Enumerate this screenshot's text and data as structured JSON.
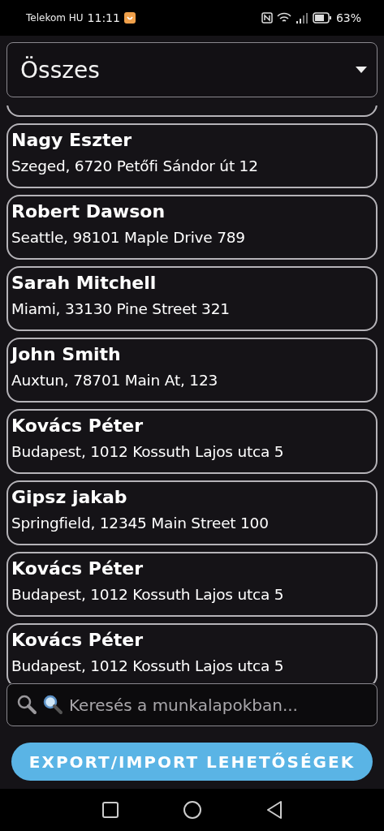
{
  "status_bar": {
    "carrier": "Telekom HU",
    "time": "11:11",
    "battery": "63%"
  },
  "filter": {
    "value": "Összes"
  },
  "cards": [
    {
      "name": "Nagy Eszter",
      "address": "Szeged, 6720 Petőfi Sándor út 12"
    },
    {
      "name": "Robert Dawson",
      "address": "Seattle, 98101 Maple Drive 789"
    },
    {
      "name": "Sarah Mitchell",
      "address": "Miami, 33130 Pine Street 321"
    },
    {
      "name": "John Smith",
      "address": "Auxtun, 78701 Main At, 123"
    },
    {
      "name": "Kovács Péter",
      "address": "Budapest, 1012 Kossuth Lajos utca 5"
    },
    {
      "name": "Gipsz jakab",
      "address": "Springfield, 12345 Main Street 100"
    },
    {
      "name": "Kovács Péter",
      "address": "Budapest, 1012 Kossuth Lajos utca 5"
    },
    {
      "name": "Kovács Péter",
      "address": "Budapest, 1012 Kossuth Lajos utca 5"
    }
  ],
  "search": {
    "placeholder": "Keresés a munkalapokban..."
  },
  "export_button": "EXPORT/IMPORT LEHETŐSÉGEK"
}
